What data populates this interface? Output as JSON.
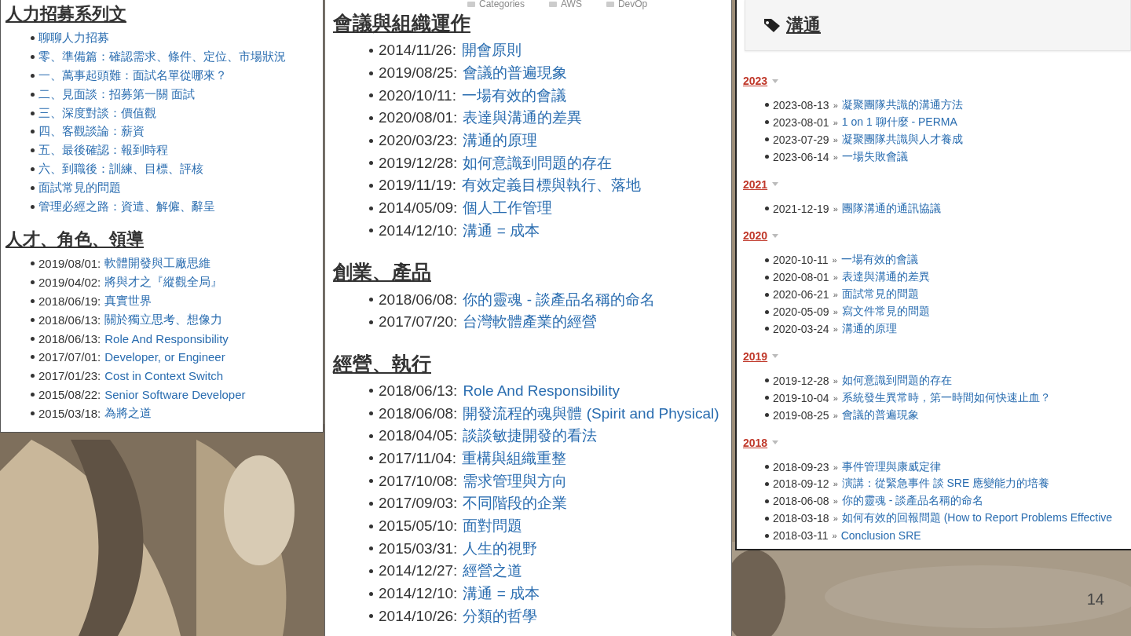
{
  "slide_number": "14",
  "panels": [
    {
      "kind": "plain",
      "sections": [
        {
          "heading": "人力招募系列文",
          "items": [
            {
              "title": "聊聊人力招募"
            },
            {
              "title": "零、準備篇：確認需求、條件、定位、市場狀況"
            },
            {
              "title": "一、萬事起頭難：面試名單從哪來？"
            },
            {
              "title": "二、見面談：招募第一關 面試"
            },
            {
              "title": "三、深度對談：價值觀"
            },
            {
              "title": "四、客觀談論：薪資"
            },
            {
              "title": "五、最後確認：報到時程"
            },
            {
              "title": "六、到職後：訓練、目標、評核"
            },
            {
              "title": "面試常見的問題"
            },
            {
              "title": "管理必經之路：資遣、解僱、辭呈"
            }
          ]
        },
        {
          "heading": "人才、角色、領導",
          "items": [
            {
              "date": "2019/08/01:",
              "title": "軟體開發與工廠思維"
            },
            {
              "date": "2019/04/02:",
              "title": "將與才之『縱觀全局』"
            },
            {
              "date": "2018/06/19:",
              "title": "真實世界"
            },
            {
              "date": "2018/06/13:",
              "title": "關於獨立思考、想像力"
            },
            {
              "date": "2018/06/13:",
              "title": "Role And Responsibility"
            },
            {
              "date": "2017/07/01:",
              "title": "Developer, or Engineer"
            },
            {
              "date": "2017/01/23:",
              "title": "Cost in Context Switch"
            },
            {
              "date": "2015/08/22:",
              "title": "Senior Software Developer"
            },
            {
              "date": "2015/03/18:",
              "title": "為將之道"
            }
          ]
        }
      ]
    },
    {
      "kind": "dated",
      "nav": [
        "Categories",
        "AWS",
        "DevOp"
      ],
      "sections": [
        {
          "heading": "會議與組織運作",
          "items": [
            {
              "date": "2014/11/26:",
              "title": "開會原則"
            },
            {
              "date": "2019/08/25:",
              "title": "會議的普遍現象"
            },
            {
              "date": "2020/10/11:",
              "title": "一場有效的會議"
            },
            {
              "date": "2020/08/01:",
              "title": "表達與溝通的差異"
            },
            {
              "date": "2020/03/23:",
              "title": "溝通的原理"
            },
            {
              "date": "2019/12/28:",
              "title": "如何意識到問題的存在"
            },
            {
              "date": "2019/11/19:",
              "title": "有效定義目標與執行、落地"
            },
            {
              "date": "2014/05/09:",
              "title": "個人工作管理"
            },
            {
              "date": "2014/12/10:",
              "title": "溝通 = 成本"
            }
          ]
        },
        {
          "heading": "創業、產品",
          "items": [
            {
              "date": "2018/06/08:",
              "title": "你的靈魂 - 談產品名稱的命名"
            },
            {
              "date": "2017/07/20:",
              "title": "台灣軟體產業的經營"
            }
          ]
        },
        {
          "heading": "經營、執行",
          "items": [
            {
              "date": "2018/06/13:",
              "title": "Role And Responsibility"
            },
            {
              "date": "2018/06/08:",
              "title": "開發流程的魂與體 (Spirit and Physical)"
            },
            {
              "date": "2018/04/05:",
              "title": "談談敏捷開發的看法"
            },
            {
              "date": "2017/11/04:",
              "title": "重構與組織重整"
            },
            {
              "date": "2017/10/08:",
              "title": "需求管理與方向"
            },
            {
              "date": "2017/09/03:",
              "title": "不同階段的企業"
            },
            {
              "date": "2015/05/10:",
              "title": "面對問題"
            },
            {
              "date": "2015/03/31:",
              "title": "人生的視野"
            },
            {
              "date": "2014/12/27:",
              "title": "經營之道"
            },
            {
              "date": "2014/12/10:",
              "title": "溝通 = 成本"
            },
            {
              "date": "2014/10/26:",
              "title": "分類的哲學"
            }
          ]
        }
      ]
    },
    {
      "kind": "archive",
      "tag": "溝通",
      "separator": "»",
      "sections": [
        {
          "year": "2023",
          "items": [
            {
              "date": "2023-08-13",
              "title": "凝聚團隊共識的溝通方法"
            },
            {
              "date": "2023-08-01",
              "title": "1 on 1 聊什麼 - PERMA"
            },
            {
              "date": "2023-07-29",
              "title": "凝聚團隊共識與人才養成"
            },
            {
              "date": "2023-06-14",
              "title": "一場失敗會議"
            }
          ]
        },
        {
          "year": "2021",
          "items": [
            {
              "date": "2021-12-19",
              "title": "團隊溝通的通訊協議"
            }
          ]
        },
        {
          "year": "2020",
          "items": [
            {
              "date": "2020-10-11",
              "title": "一場有效的會議"
            },
            {
              "date": "2020-08-01",
              "title": "表達與溝通的差異"
            },
            {
              "date": "2020-06-21",
              "title": "面試常見的問題"
            },
            {
              "date": "2020-05-09",
              "title": "寫文件常見的問題"
            },
            {
              "date": "2020-03-24",
              "title": "溝通的原理"
            }
          ]
        },
        {
          "year": "2019",
          "items": [
            {
              "date": "2019-12-28",
              "title": "如何意識到問題的存在"
            },
            {
              "date": "2019-10-04",
              "title": "系統發生異常時，第一時間如何快速止血？"
            },
            {
              "date": "2019-08-25",
              "title": "會議的普遍現象"
            }
          ]
        },
        {
          "year": "2018",
          "items": [
            {
              "date": "2018-09-23",
              "title": "事件管理與康威定律"
            },
            {
              "date": "2018-09-12",
              "title": "演講：從緊急事件 談 SRE 應變能力的培養"
            },
            {
              "date": "2018-06-08",
              "title": "你的靈魂 - 談產品名稱的命名"
            },
            {
              "date": "2018-03-18",
              "title": "如何有效的回報問題 (How to Report Problems Effective"
            },
            {
              "date": "2018-03-11",
              "title": "Conclusion SRE"
            }
          ]
        }
      ]
    }
  ]
}
